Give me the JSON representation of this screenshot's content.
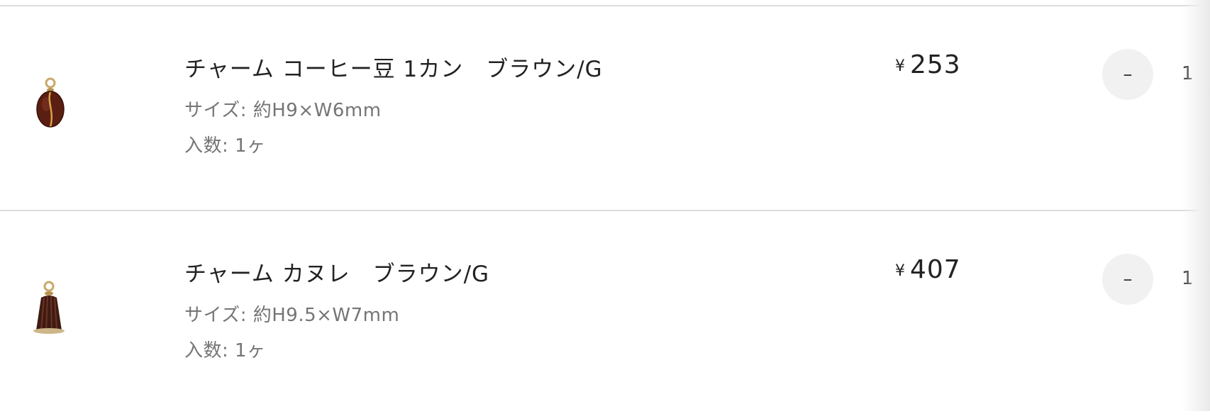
{
  "cart": {
    "items": [
      {
        "name": "チャーム コーヒー豆 1カン　ブラウン/G",
        "size": "サイズ: 約H9×W6mm",
        "count": "入数: 1ヶ",
        "currency": "¥",
        "price": "253",
        "minus_label": "–",
        "quantity": "1",
        "thumb_icon": "coffee-bean-charm-icon"
      },
      {
        "name": "チャーム カヌレ　ブラウン/G",
        "size": "サイズ: 約H9.5×W7mm",
        "count": "入数: 1ヶ",
        "currency": "¥",
        "price": "407",
        "minus_label": "–",
        "quantity": "1",
        "thumb_icon": "canele-charm-icon"
      }
    ]
  }
}
